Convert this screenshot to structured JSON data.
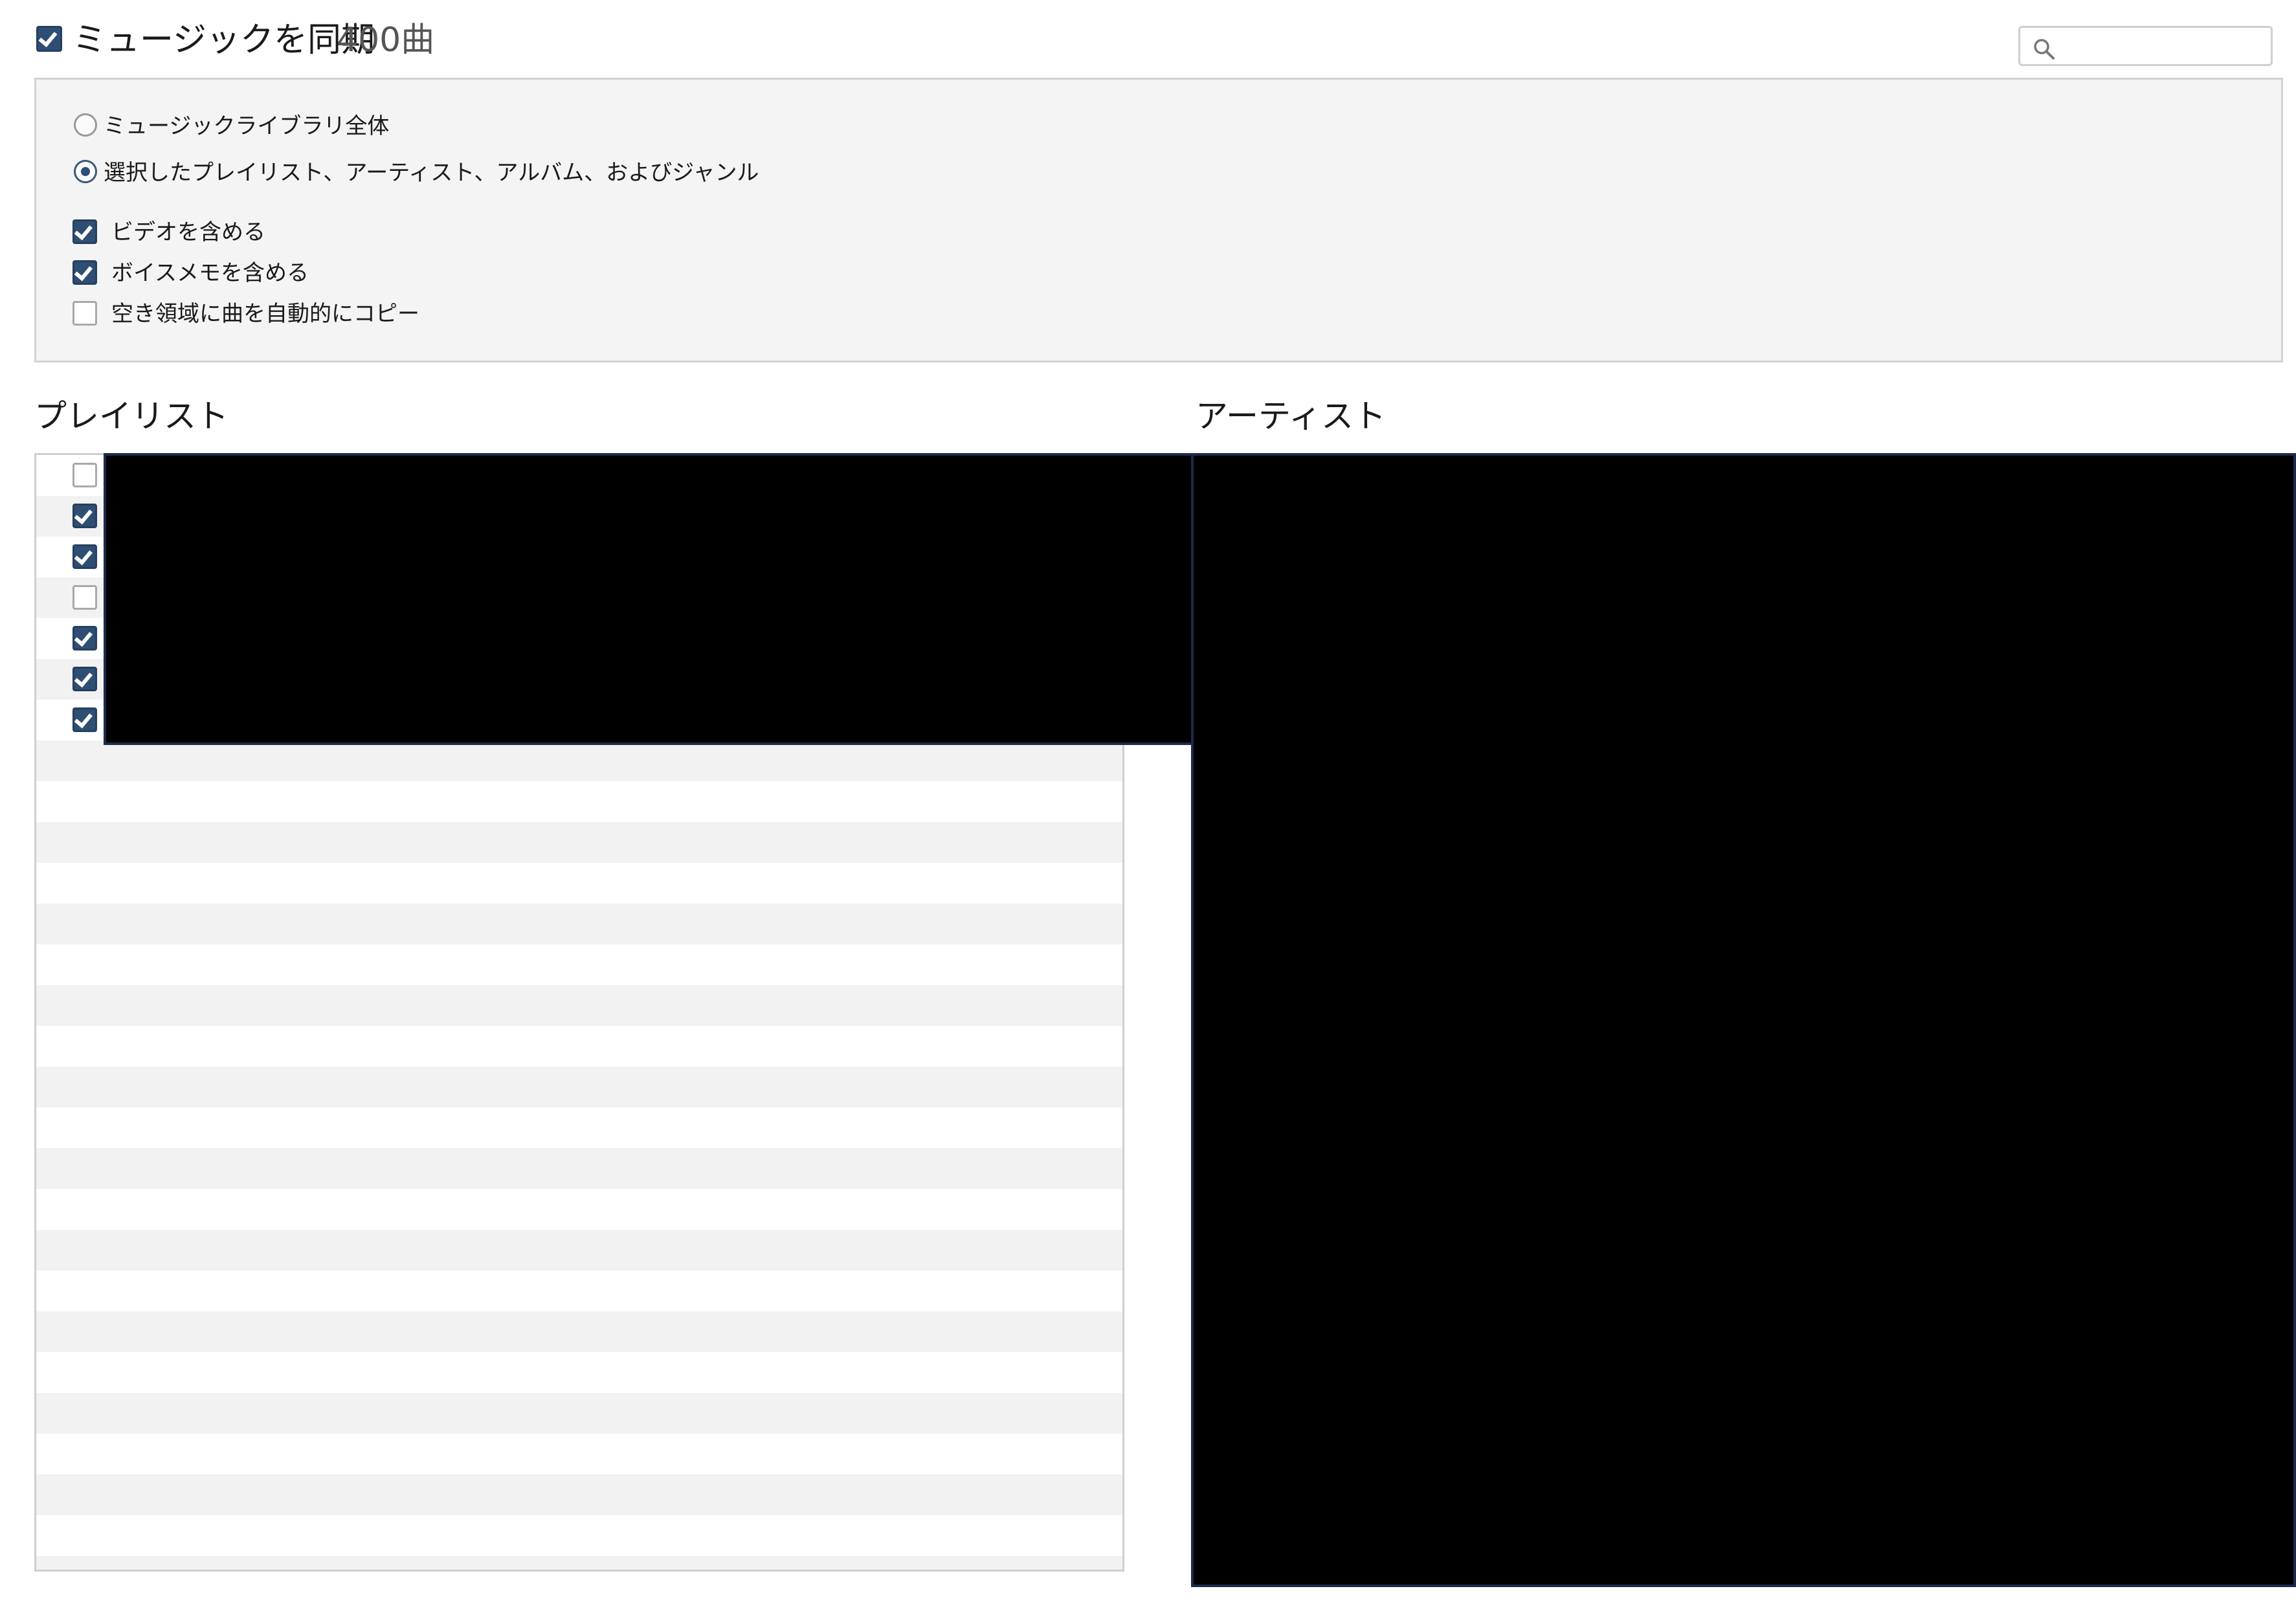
{
  "header": {
    "sync_checked": true,
    "title": "ミュージックを同期",
    "count": "400曲"
  },
  "search": {
    "icon": "search-icon",
    "placeholder": "",
    "value": ""
  },
  "options": {
    "radios": [
      {
        "label": "ミュージックライブラリ全体",
        "selected": false
      },
      {
        "label": "選択したプレイリスト、アーティスト、アルバム、およびジャンル",
        "selected": true
      }
    ],
    "checkboxes": [
      {
        "label": "ビデオを含める",
        "checked": true
      },
      {
        "label": "ボイスメモを含める",
        "checked": true
      },
      {
        "label": "空き領域に曲を自動的にコピー",
        "checked": false
      }
    ]
  },
  "playlists": {
    "heading": "プレイリスト",
    "items": [
      {
        "checked": false
      },
      {
        "checked": true
      },
      {
        "checked": true
      },
      {
        "checked": false
      },
      {
        "checked": true
      },
      {
        "checked": true
      },
      {
        "checked": true
      }
    ]
  },
  "artists": {
    "heading": "アーティスト"
  },
  "colors": {
    "check_fill": "#2f4e74",
    "row_alt": "#f2f2f2",
    "panel_bg": "#f4f4f4",
    "redaction": "#000000"
  }
}
